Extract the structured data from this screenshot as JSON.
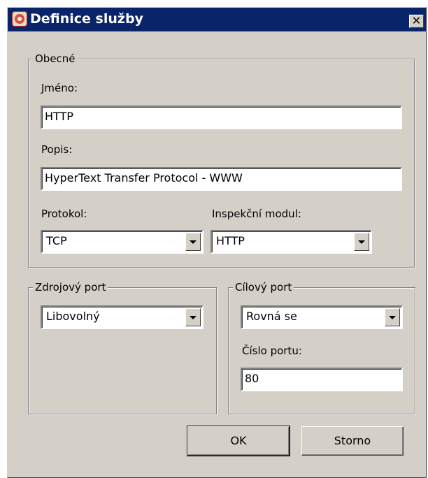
{
  "window": {
    "title": "Definice služby",
    "close_glyph": "✕"
  },
  "general": {
    "legend": "Obecné",
    "name_label": "Jméno:",
    "name_value": "HTTP",
    "description_label": "Popis:",
    "description_value": "HyperText Transfer Protocol - WWW",
    "protocol_label": "Protokol:",
    "protocol_value": "TCP",
    "inspection_label": "Inspekční modul:",
    "inspection_value": "HTTP"
  },
  "source_port": {
    "legend": "Zdrojový port",
    "mode_value": "Libovolný"
  },
  "dest_port": {
    "legend": "Cílový port",
    "mode_value": "Rovná se",
    "port_label": "Číslo portu:",
    "port_value": "80"
  },
  "buttons": {
    "ok": "OK",
    "cancel": "Storno"
  },
  "icons": {
    "app": "service-definition-icon",
    "close": "close-icon",
    "dropdown": "chevron-down-icon"
  }
}
